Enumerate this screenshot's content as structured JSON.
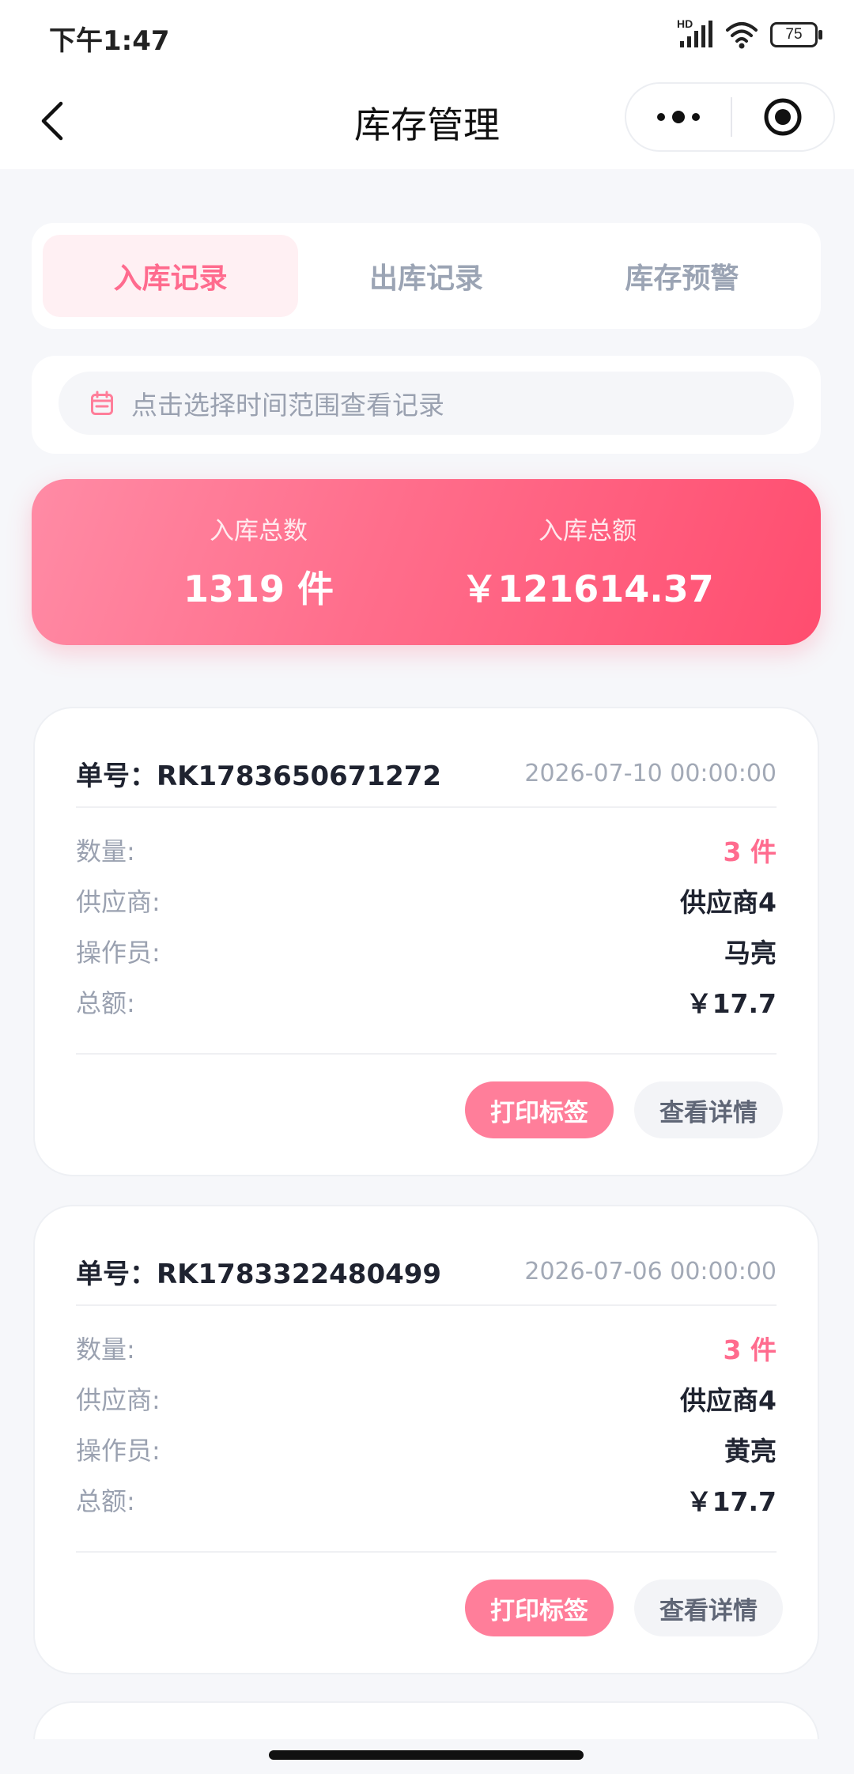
{
  "status_bar": {
    "time": "下午1:47",
    "signal_label": "HD",
    "battery": "75"
  },
  "nav": {
    "title": "库存管理"
  },
  "tabs": [
    {
      "label": "入库记录",
      "active": true
    },
    {
      "label": "出库记录",
      "active": false
    },
    {
      "label": "库存预警",
      "active": false
    }
  ],
  "date_filter": {
    "placeholder": "点击选择时间范围查看记录"
  },
  "summary": {
    "count_label": "入库总数",
    "count_value": "1319 件",
    "amount_label": "入库总额",
    "amount_value": "￥121614.37"
  },
  "labels": {
    "order_prefix": "单号：",
    "quantity": "数量:",
    "supplier": "供应商:",
    "operator": "操作员:",
    "total": "总额:",
    "print_button": "打印标签",
    "detail_button": "查看详情"
  },
  "records": [
    {
      "order_no": "RK1783650671272",
      "date": "2026-07-10 00:00:00",
      "quantity": "3 件",
      "supplier": "供应商4",
      "operator": "马亮",
      "total": "￥17.7"
    },
    {
      "order_no": "RK1783322480499",
      "date": "2026-07-06 00:00:00",
      "quantity": "3 件",
      "supplier": "供应商4",
      "operator": "黄亮",
      "total": "￥17.7"
    }
  ],
  "colors": {
    "accent": "#ff6b8e",
    "gradient_start": "#ff8ba5",
    "gradient_end": "#ff4d6f"
  }
}
